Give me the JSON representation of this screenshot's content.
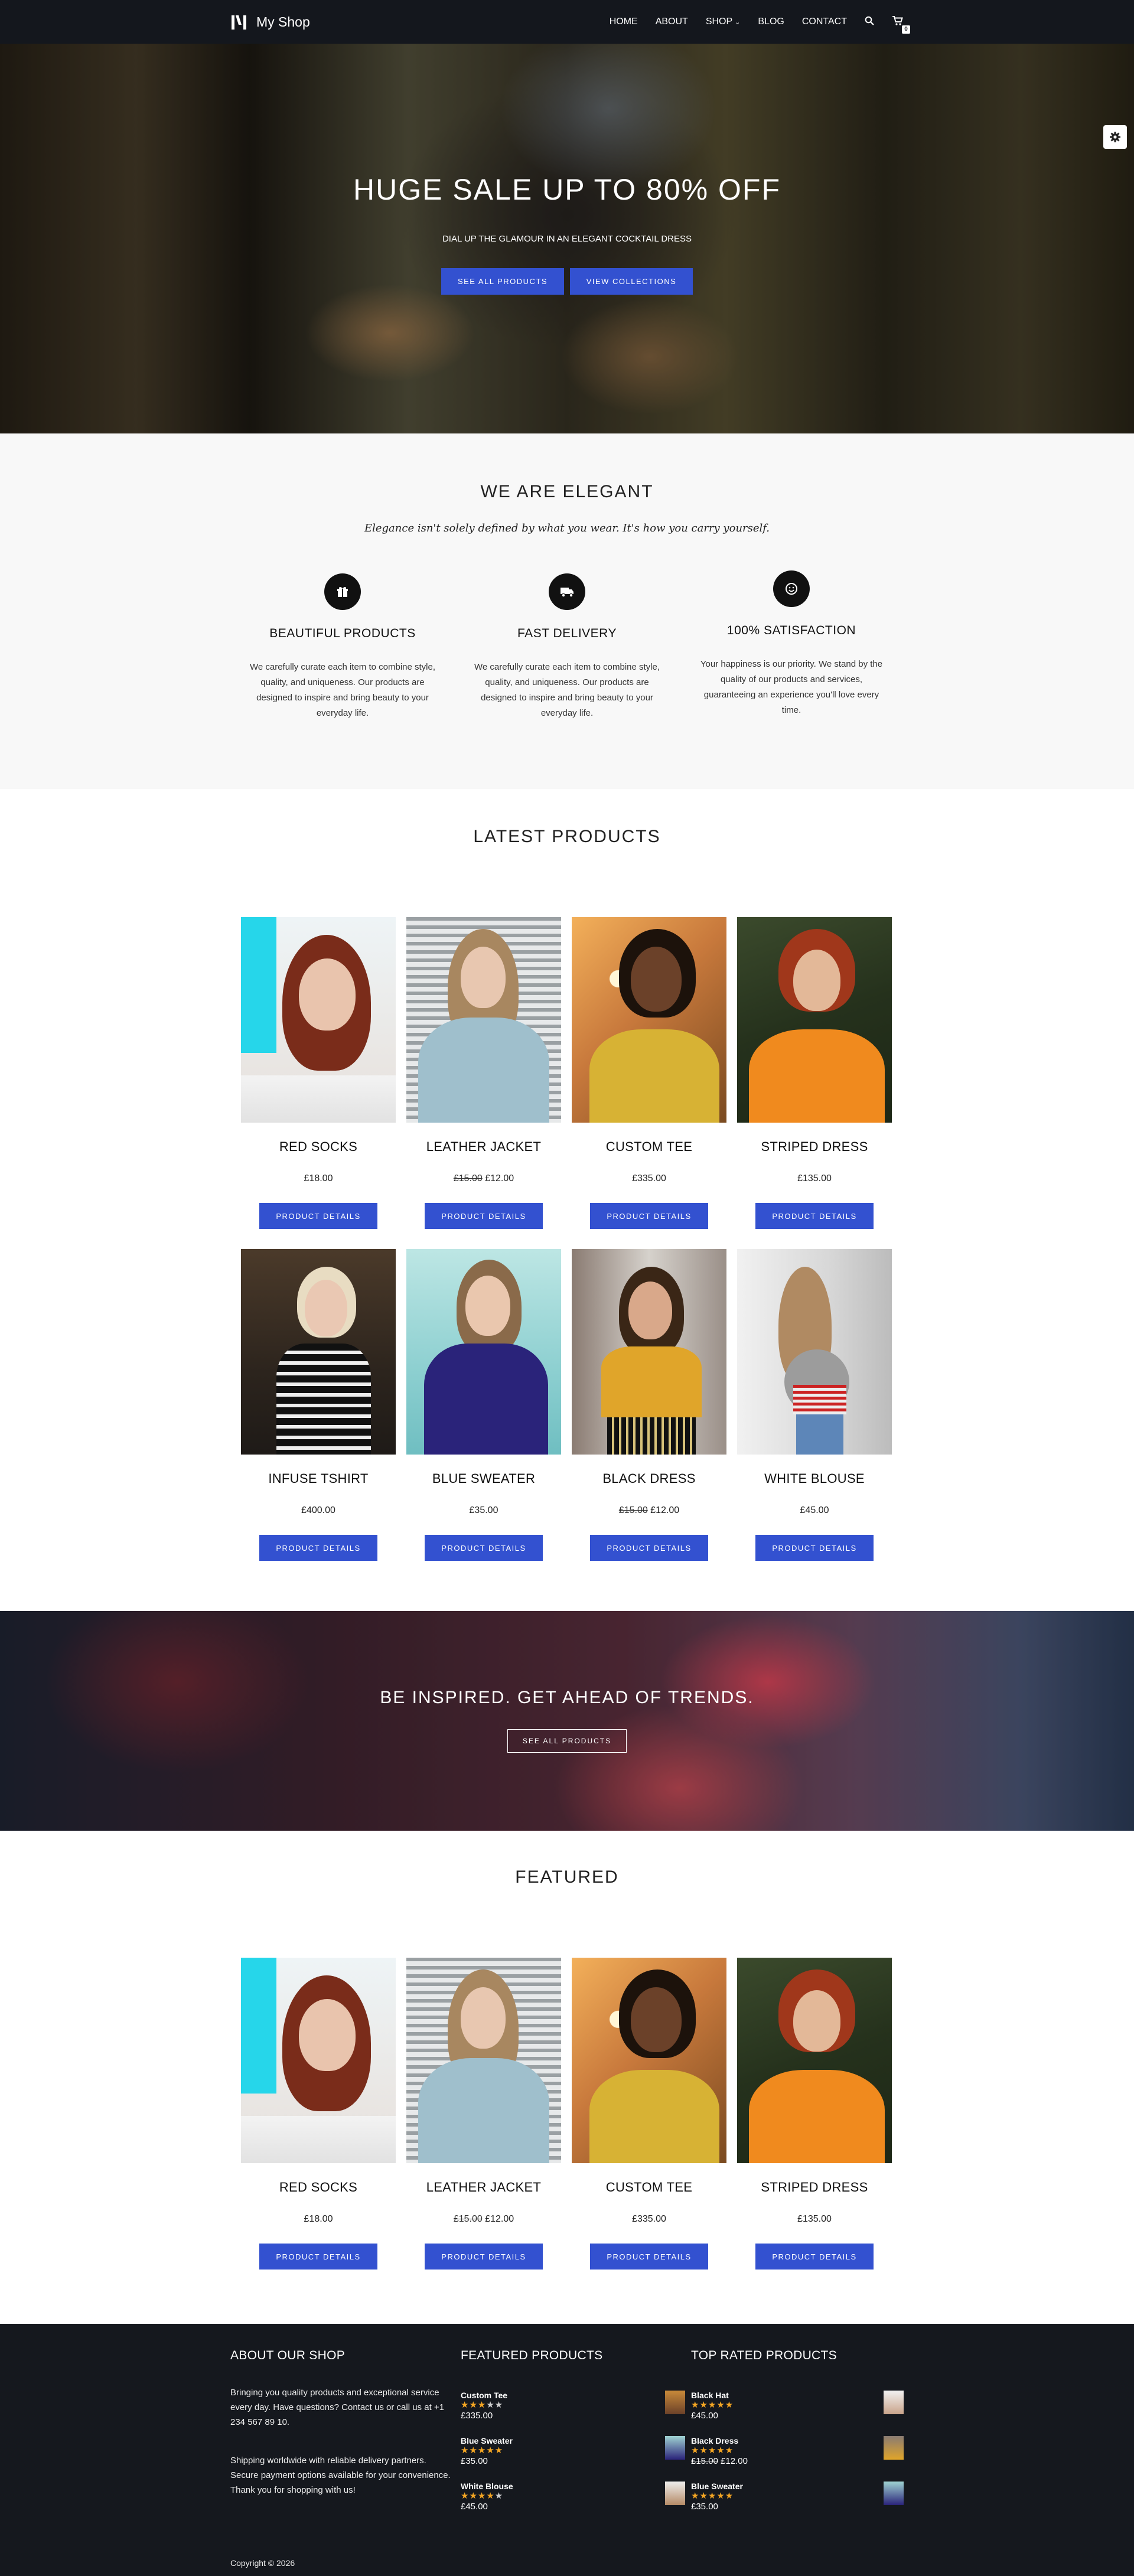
{
  "header": {
    "brand": "My Shop",
    "nav": {
      "home": "HOME",
      "about": "ABOUT",
      "shop": "SHOP",
      "shop_caret": "⌄",
      "blog": "BLOG",
      "contact": "CONTACT"
    },
    "cart_count": "0",
    "icons": [
      "search-icon",
      "cart-icon",
      "gear-icon"
    ]
  },
  "hero": {
    "title": "HUGE SALE UP TO 80% OFF",
    "subtitle": "DIAL UP THE GLAMOUR IN AN ELEGANT COCKTAIL DRESS",
    "btn_primary": "SEE ALL PRODUCTS",
    "btn_secondary": "VIEW COLLECTIONS"
  },
  "elegant": {
    "title": "WE ARE ELEGANT",
    "tagline": "Elegance isn't solely defined by what you wear. It's how you carry yourself.",
    "features": [
      {
        "icon": "gift-icon",
        "title": "BEAUTIFUL PRODUCTS",
        "text": "We carefully curate each item to combine style, quality, and uniqueness. Our products are designed to inspire and bring beauty to your everyday life."
      },
      {
        "icon": "truck-icon",
        "title": "FAST DELIVERY",
        "text": "We carefully curate each item to combine style, quality, and uniqueness. Our products are designed to inspire and bring beauty to your everyday life."
      },
      {
        "icon": "smile-icon",
        "title": "100% SATISFACTION",
        "text": "Your happiness is our priority. We stand by the quality of our products and services, guaranteeing an experience you'll love every time."
      }
    ]
  },
  "latest": {
    "title": "LATEST PRODUCTS",
    "button_label": "PRODUCT DETAILS",
    "products": [
      {
        "name": "RED SOCKS",
        "old_price": "",
        "price": "£18.00"
      },
      {
        "name": "LEATHER JACKET",
        "old_price": "£15.00",
        "price": "£12.00"
      },
      {
        "name": "CUSTOM TEE",
        "old_price": "",
        "price": "£335.00"
      },
      {
        "name": "STRIPED DRESS",
        "old_price": "",
        "price": "£135.00"
      },
      {
        "name": "INFUSE TSHIRT",
        "old_price": "",
        "price": "£400.00"
      },
      {
        "name": "BLUE SWEATER",
        "old_price": "",
        "price": "£35.00"
      },
      {
        "name": "BLACK DRESS",
        "old_price": "£15.00",
        "price": "£12.00"
      },
      {
        "name": "WHITE BLOUSE",
        "old_price": "",
        "price": "£45.00"
      }
    ]
  },
  "inspired": {
    "title": "BE INSPIRED. GET AHEAD OF TRENDS.",
    "button": "SEE ALL PRODUCTS"
  },
  "featured": {
    "title": "FEATURED",
    "button_label": "PRODUCT DETAILS",
    "products": [
      {
        "name": "RED SOCKS",
        "old_price": "",
        "price": "£18.00"
      },
      {
        "name": "LEATHER JACKET",
        "old_price": "£15.00",
        "price": "£12.00"
      },
      {
        "name": "CUSTOM TEE",
        "old_price": "",
        "price": "£335.00"
      },
      {
        "name": "STRIPED DRESS",
        "old_price": "",
        "price": "£135.00"
      }
    ]
  },
  "footer": {
    "about_title": "ABOUT OUR SHOP",
    "about_text_1": "Bringing you quality products and exceptional service every day. Have questions? Contact us or call us at +1 234 567 89 10.",
    "about_text_2": "Shipping worldwide with reliable delivery partners. Secure payment options available for your convenience. Thank you for shopping with us!",
    "featured_title": "FEATURED PRODUCTS",
    "featured_items": [
      {
        "name": "Custom Tee",
        "rating": 3,
        "old_price": "",
        "price": "£335.00"
      },
      {
        "name": "Blue Sweater",
        "rating": 5,
        "old_price": "",
        "price": "£35.00"
      },
      {
        "name": "White Blouse",
        "rating": 4,
        "old_price": "",
        "price": "£45.00"
      }
    ],
    "top_title": "TOP RATED PRODUCTS",
    "top_items": [
      {
        "name": "Black Hat",
        "rating": 5,
        "old_price": "",
        "price": "£45.00"
      },
      {
        "name": "Black Dress",
        "rating": 5,
        "old_price": "£15.00",
        "price": "£12.00"
      },
      {
        "name": "Blue Sweater",
        "rating": 5,
        "old_price": "",
        "price": "£35.00"
      }
    ],
    "copyright": "Copyright © 2026"
  },
  "colors": {
    "accent": "#3351d0",
    "dark": "#14171d",
    "star": "#f5a623"
  }
}
